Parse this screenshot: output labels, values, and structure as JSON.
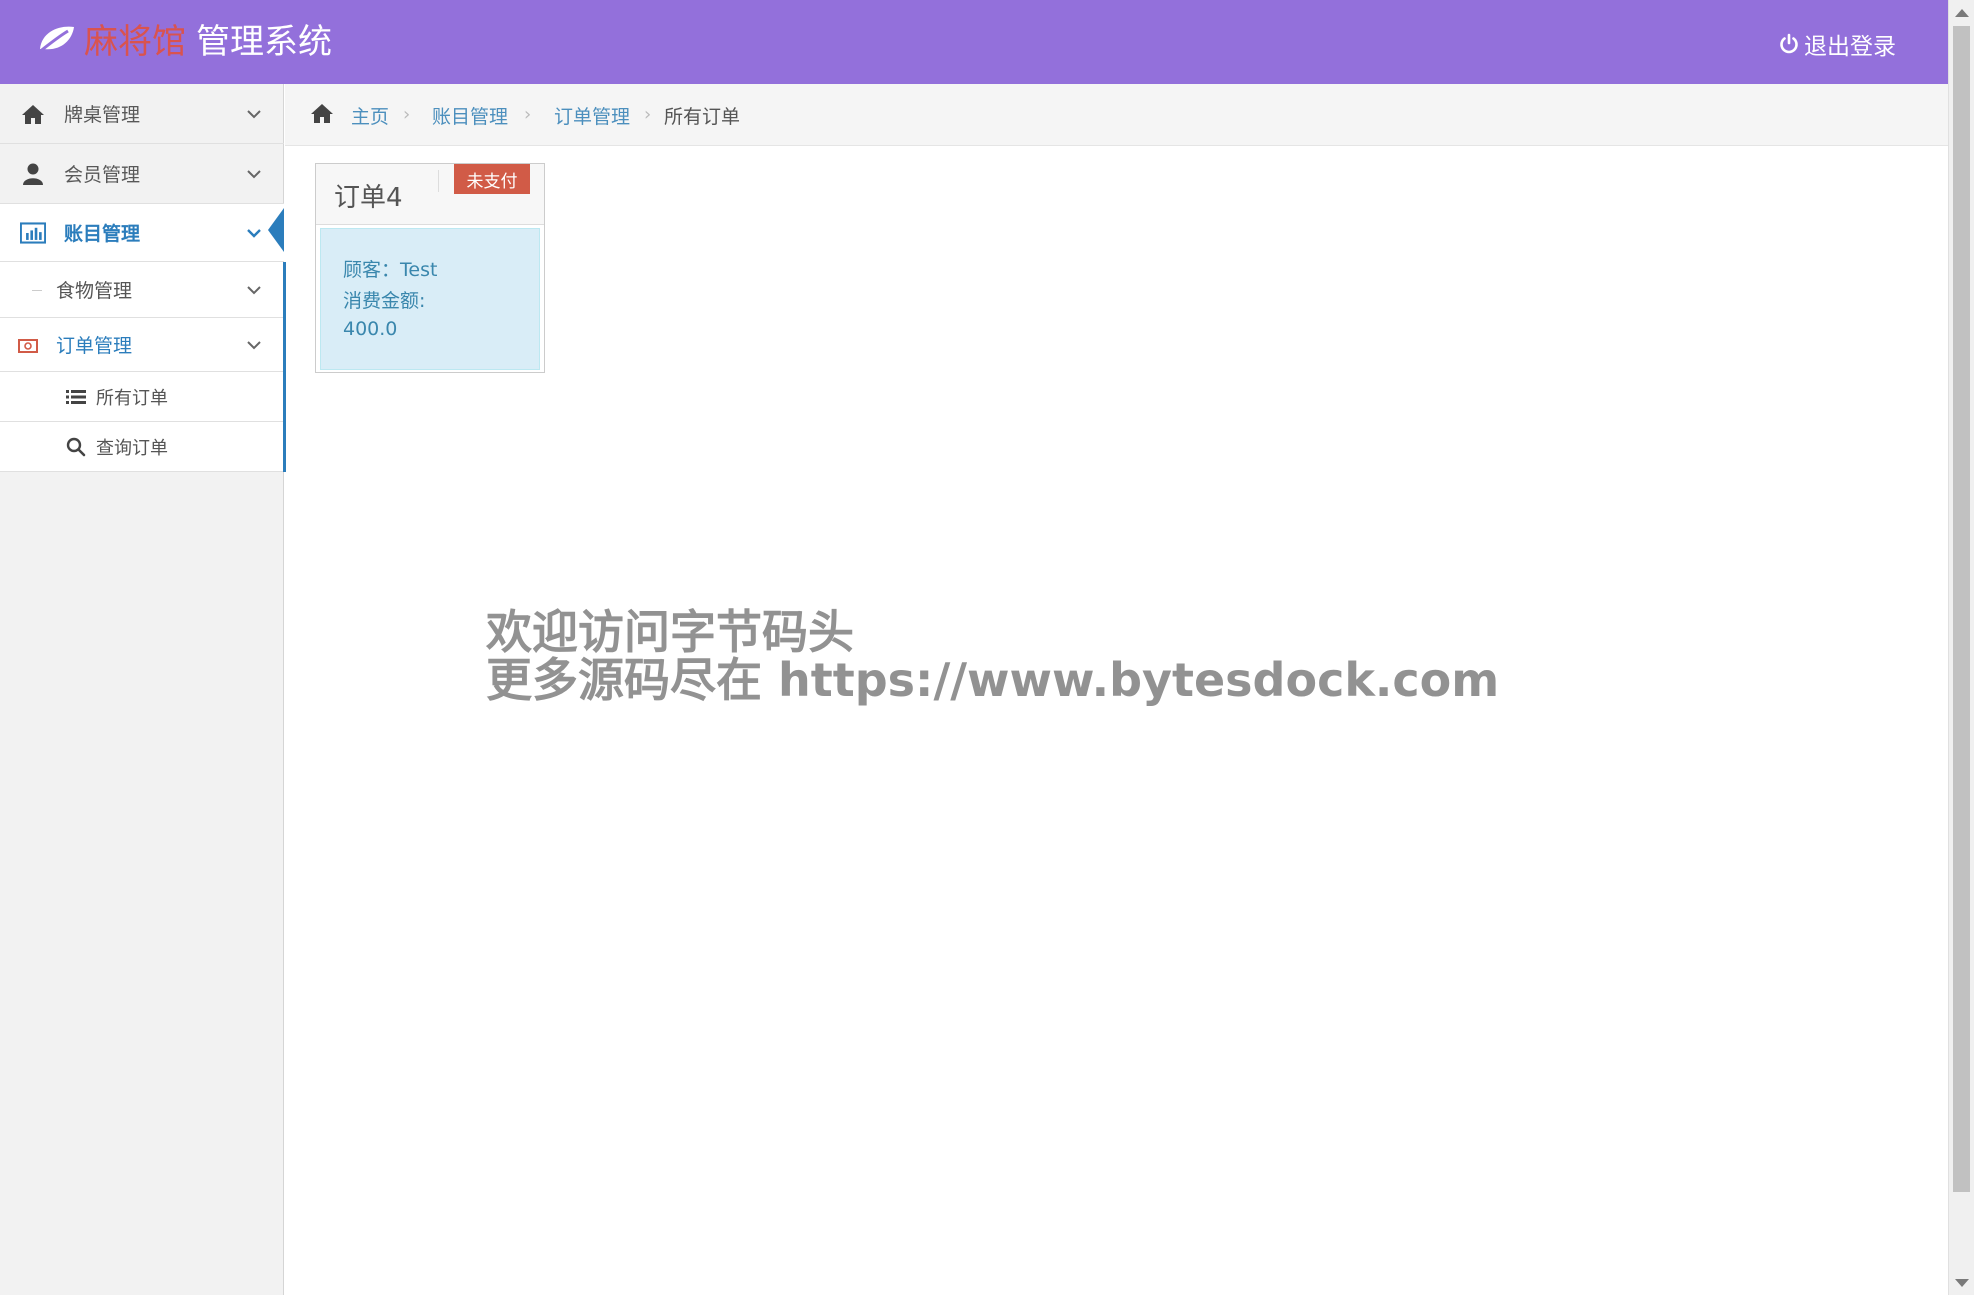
{
  "header": {
    "brand_name": "麻将馆",
    "brand_suffix": "管理系统",
    "logout_label": "退出登录",
    "bg_color": "#9370DB"
  },
  "sidebar": {
    "items": [
      {
        "label": "牌桌管理",
        "icon": "home-icon"
      },
      {
        "label": "会员管理",
        "icon": "user-icon"
      },
      {
        "label": "账目管理",
        "icon": "bar-chart-icon",
        "active": true
      },
      {
        "label": "食物管理",
        "icon": "dash-icon"
      },
      {
        "label": "订单管理",
        "icon": "money-icon"
      }
    ],
    "sub_items": [
      {
        "label": "所有订单",
        "icon": "list-icon"
      },
      {
        "label": "查询订单",
        "icon": "search-icon"
      }
    ]
  },
  "breadcrumb": {
    "home": "主页",
    "level1": "账目管理",
    "level2": "订单管理",
    "current": "所有订单"
  },
  "order_card": {
    "title": "订单4",
    "status": "未支付",
    "customer_line": "顾客：Test",
    "amount_label": "消费金额:",
    "amount_value": "400.0"
  },
  "watermark": {
    "line1": "欢迎访问字节码头",
    "line2": "更多源码尽在  https://www.bytesdock.com"
  },
  "colors": {
    "accent": "#2b7dbc",
    "danger": "#d15b47",
    "info_bg": "#d9edf7"
  }
}
